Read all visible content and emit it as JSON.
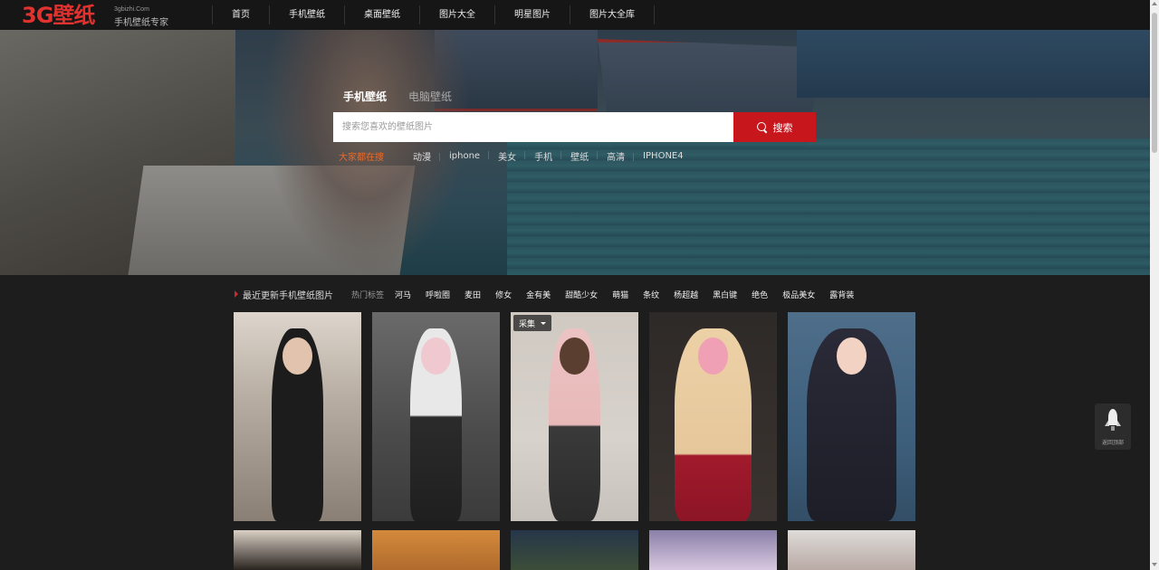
{
  "header": {
    "logo_text": "3G壁纸",
    "logo_domain": "3gbizhi.Com",
    "logo_tagline": "手机壁纸专家",
    "nav": [
      "首页",
      "手机壁纸",
      "桌面壁纸",
      "图片大全",
      "明星图片",
      "图片大全库"
    ]
  },
  "hero": {
    "tabs": [
      "手机壁纸",
      "电脑壁纸"
    ],
    "active_tab": "手机壁纸",
    "search_placeholder": "搜索您喜欢的壁纸图片",
    "search_button": "搜索",
    "quick_label": "大家都在搜",
    "quick_tags": [
      "动漫",
      "iphone",
      "美女",
      "手机",
      "壁纸",
      "高清",
      "IPHONE4"
    ]
  },
  "section": {
    "title": "最近更新手机壁纸图片",
    "hot_label": "热门标签",
    "hot_tags": [
      "河马",
      "呼啦圈",
      "麦田",
      "修女",
      "金有美",
      "甜酷少女",
      "萌猫",
      "条纹",
      "杨超越",
      "黑白键",
      "绝色",
      "极品美女",
      "露背装"
    ]
  },
  "cards": {
    "overlay_label": "采集"
  },
  "back_to_top": {
    "label": "返回顶部"
  },
  "colors": {
    "accent": "#c8161d",
    "logo": "#e0322f",
    "background": "#1d1d1d",
    "quick_label": "#e86a2a"
  }
}
